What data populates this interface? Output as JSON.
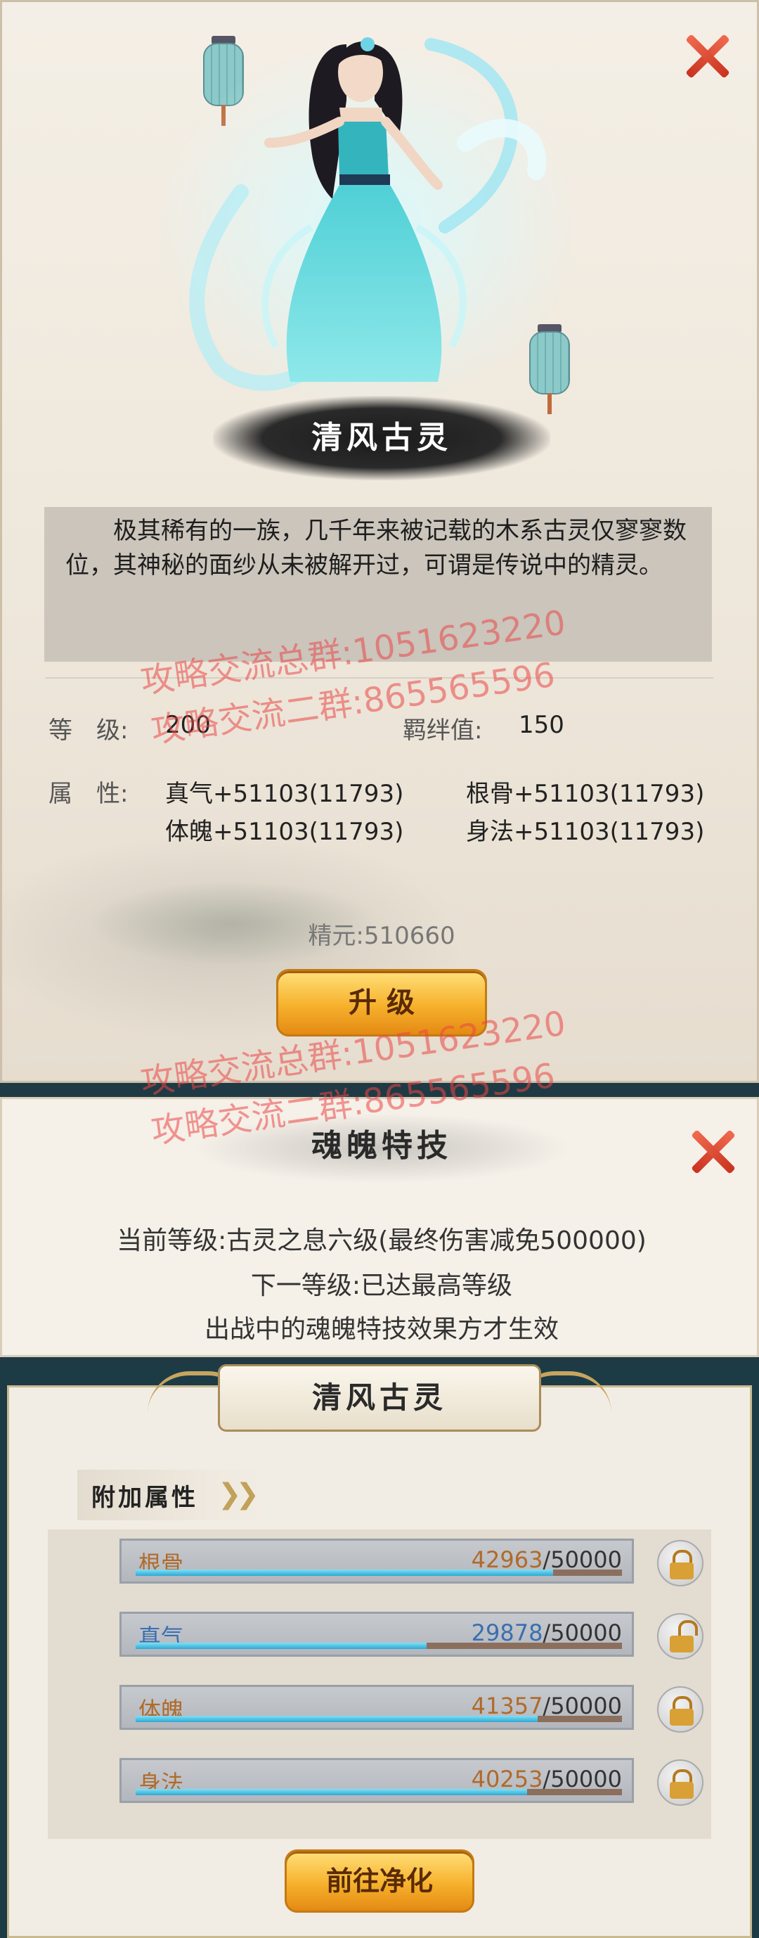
{
  "spirit": {
    "name": "清风古灵",
    "description": "极其稀有的一族，几千年来被记载的木系古灵仅寥寥数位，其神秘的面纱从未被解开过，可谓是传说中的精灵。",
    "level_label": "等　级:",
    "level_value": "200",
    "bond_label": "羁绊值:",
    "bond_value": "150",
    "attr_label": "属　性:",
    "attrs": [
      "真气+51103(11793)",
      "根骨+51103(11793)",
      "体魄+51103(11793)",
      "身法+51103(11793)"
    ],
    "essence": "精元:510660",
    "upgrade_label": "升 级"
  },
  "watermarks": [
    "攻略交流总群:1051623220",
    "攻略交流二群:865565596",
    "攻略交流总群:1051623220",
    "攻略交流二群:865565596"
  ],
  "skill": {
    "title": "魂魄特技",
    "current": "当前等级:古灵之息六级(最终伤害减免500000)",
    "next": "下一等级:已达最高等级",
    "note": "出战中的魂魄特技效果方才生效"
  },
  "attributes_panel": {
    "title": "清风古灵",
    "section": "附加属性",
    "rows": [
      {
        "name": "根骨",
        "current": "42963",
        "max": "/50000",
        "fraction": 0.859,
        "name_color": "#b06a2a",
        "num_color": "#b06a2a",
        "lock": "locked"
      },
      {
        "name": "真气",
        "current": "29878",
        "max": "/50000",
        "fraction": 0.598,
        "name_color": "#3a6fb0",
        "num_color": "#3a6fb0",
        "lock": "unlocked"
      },
      {
        "name": "体魄",
        "current": "41357",
        "max": "/50000",
        "fraction": 0.827,
        "name_color": "#b06a2a",
        "num_color": "#b06a2a",
        "lock": "locked"
      },
      {
        "name": "身法",
        "current": "40253",
        "max": "/50000",
        "fraction": 0.805,
        "name_color": "#b06a2a",
        "num_color": "#b06a2a",
        "lock": "locked"
      }
    ],
    "purify_label": "前往净化"
  }
}
